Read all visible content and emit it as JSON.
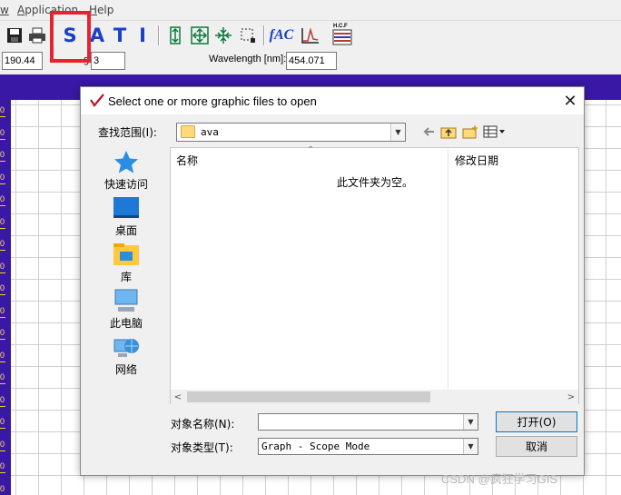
{
  "menu": {
    "items": [
      {
        "prefix": "",
        "underline": "w",
        "rest": ""
      },
      {
        "prefix": "",
        "underline": "A",
        "rest": "pplication"
      },
      {
        "prefix": "",
        "underline": "H",
        "rest": "elp"
      }
    ]
  },
  "toolbar": {
    "icons": [
      "save-icon",
      "print-icon",
      "sample-mode-s",
      "ascan-mode-a",
      "transmittance-mode-t",
      "irradiance-mode-i",
      "autoscale-y-icon",
      "autoscale-xy-icon",
      "zoom-fit-icon",
      "zoom-box-icon",
      "spectrum-fit-icon",
      "peak-icon",
      "hcf-icon"
    ],
    "mode_letters": [
      "S",
      "A",
      "T",
      "I"
    ],
    "text_labels": [
      "fAC",
      "H.C.F"
    ]
  },
  "params": {
    "value1": "190.44",
    "label2": "g",
    "value2": "3",
    "wavelength_label": "Wavelength [nm]:",
    "wavelength_value": "454.071"
  },
  "plot": {
    "y_tick_labels": [
      "0",
      "0",
      "0",
      "0",
      "0",
      "0",
      "0",
      "0",
      "0",
      "0",
      "0",
      "0",
      "0",
      "0",
      "0",
      "0",
      "0",
      "0"
    ]
  },
  "dialog": {
    "title": "Select one or more graphic files to open",
    "close_symbol": "✕",
    "lookin_label": "查找范围(I):",
    "lookin_value": "ava",
    "places": [
      {
        "label": "快速访问",
        "icon": "star-icon"
      },
      {
        "label": "桌面",
        "icon": "desktop-icon"
      },
      {
        "label": "库",
        "icon": "library-icon"
      },
      {
        "label": "此电脑",
        "icon": "computer-icon"
      },
      {
        "label": "网络",
        "icon": "network-icon"
      }
    ],
    "columns": {
      "name": "名称",
      "date": "修改日期"
    },
    "empty_message": "此文件夹为空。",
    "filename_label": "对象名称(N):",
    "filename_value": "",
    "filetype_label": "对象类型(T):",
    "filetype_value": "Graph - Scope Mode",
    "open_label": "打开(O)",
    "cancel_label": "取消"
  },
  "watermark": "CSDN @疯狂学习GIS",
  "colors": {
    "highlight": "#e8232f",
    "plot_frame": "#3a18a6",
    "toolbar_blue": "#1a3fc8"
  }
}
